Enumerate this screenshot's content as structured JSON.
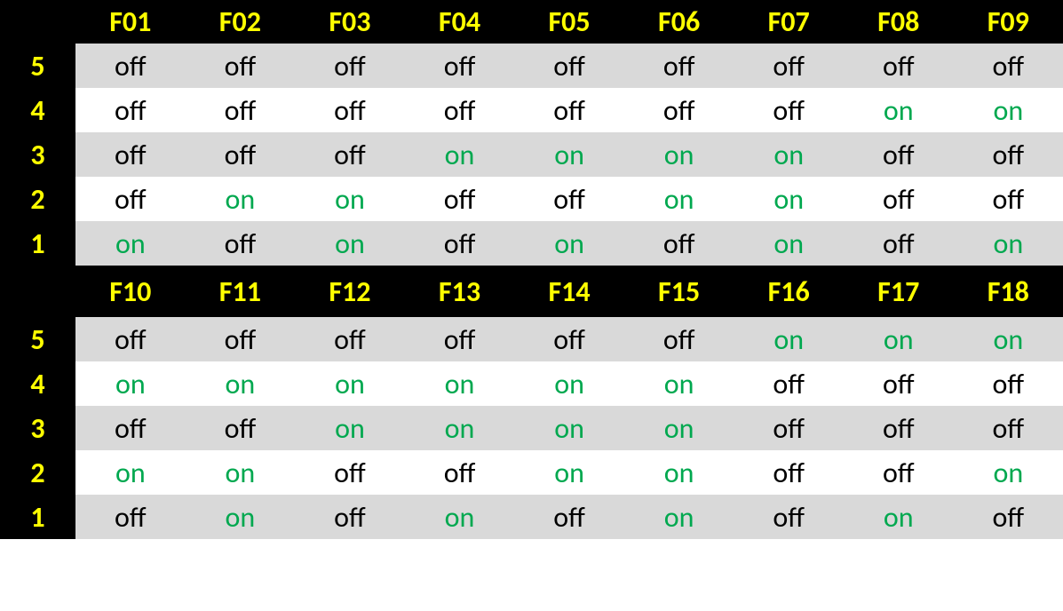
{
  "chart_data": {
    "type": "table",
    "title": "",
    "groups": [
      {
        "columns": [
          "F01",
          "F02",
          "F03",
          "F04",
          "F05",
          "F06",
          "F07",
          "F08",
          "F09"
        ],
        "rows": [
          {
            "label": "5",
            "values": [
              "off",
              "off",
              "off",
              "off",
              "off",
              "off",
              "off",
              "off",
              "off"
            ]
          },
          {
            "label": "4",
            "values": [
              "off",
              "off",
              "off",
              "off",
              "off",
              "off",
              "off",
              "on",
              "on"
            ]
          },
          {
            "label": "3",
            "values": [
              "off",
              "off",
              "off",
              "on",
              "on",
              "on",
              "on",
              "off",
              "off"
            ]
          },
          {
            "label": "2",
            "values": [
              "off",
              "on",
              "on",
              "off",
              "off",
              "on",
              "on",
              "off",
              "off"
            ]
          },
          {
            "label": "1",
            "values": [
              "on",
              "off",
              "on",
              "off",
              "on",
              "off",
              "on",
              "off",
              "on"
            ]
          }
        ]
      },
      {
        "columns": [
          "F10",
          "F11",
          "F12",
          "F13",
          "F14",
          "F15",
          "F16",
          "F17",
          "F18"
        ],
        "rows": [
          {
            "label": "5",
            "values": [
              "off",
              "off",
              "off",
              "off",
              "off",
              "off",
              "on",
              "on",
              "on"
            ]
          },
          {
            "label": "4",
            "values": [
              "on",
              "on",
              "on",
              "on",
              "on",
              "on",
              "off",
              "off",
              "off"
            ]
          },
          {
            "label": "3",
            "values": [
              "off",
              "off",
              "on",
              "on",
              "on",
              "on",
              "off",
              "off",
              "off"
            ]
          },
          {
            "label": "2",
            "values": [
              "on",
              "on",
              "off",
              "off",
              "on",
              "on",
              "off",
              "off",
              "on"
            ]
          },
          {
            "label": "1",
            "values": [
              "off",
              "on",
              "off",
              "on",
              "off",
              "on",
              "off",
              "on",
              "off"
            ]
          }
        ]
      }
    ]
  },
  "colors": {
    "header_bg": "#000000",
    "header_text": "#ffff00",
    "shaded_bg": "#d9d9d9",
    "plain_bg": "#ffffff",
    "off_text": "#000000",
    "on_text": "#00a84f"
  }
}
